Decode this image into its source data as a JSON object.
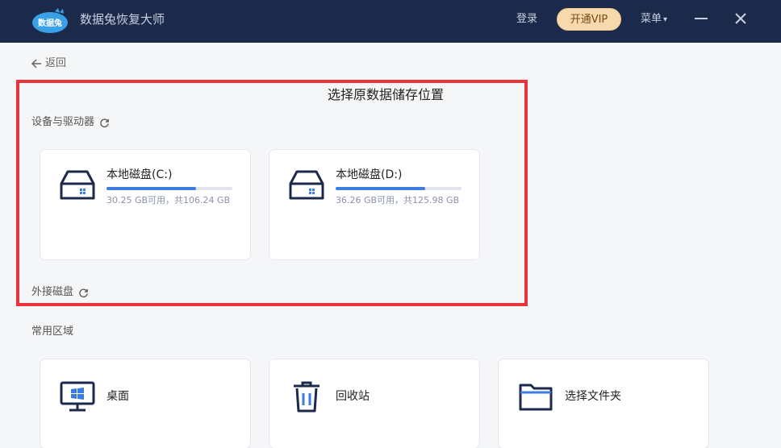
{
  "app": {
    "title": "数据兔恢复大师",
    "logo_text": "数据兔",
    "login_label": "登录",
    "vip_label": "开通VIP",
    "menu_label": "菜单",
    "menu_caret": "▾"
  },
  "nav": {
    "back_label": "返回"
  },
  "main": {
    "heading": "选择原数据储存位置",
    "devices_label": "设备与驱动器",
    "external_label": "外接磁盘",
    "common_label": "常用区域"
  },
  "drives": [
    {
      "name": "本地磁盘(C:)",
      "space": "30.25 GB可用，共106.24 GB",
      "used_fraction": 0.71
    },
    {
      "name": "本地磁盘(D:)",
      "space": "36.26 GB可用，共125.98 GB",
      "used_fraction": 0.71
    }
  ],
  "common": [
    {
      "label": "桌面",
      "icon": "desktop-icon"
    },
    {
      "label": "回收站",
      "icon": "trash-icon"
    },
    {
      "label": "选择文件夹",
      "icon": "folder-icon"
    }
  ],
  "colors": {
    "titlebar": "#1b2a4a",
    "accent": "#3b7de0",
    "highlight": "#e8333a",
    "vip": "#f7d9ae"
  }
}
